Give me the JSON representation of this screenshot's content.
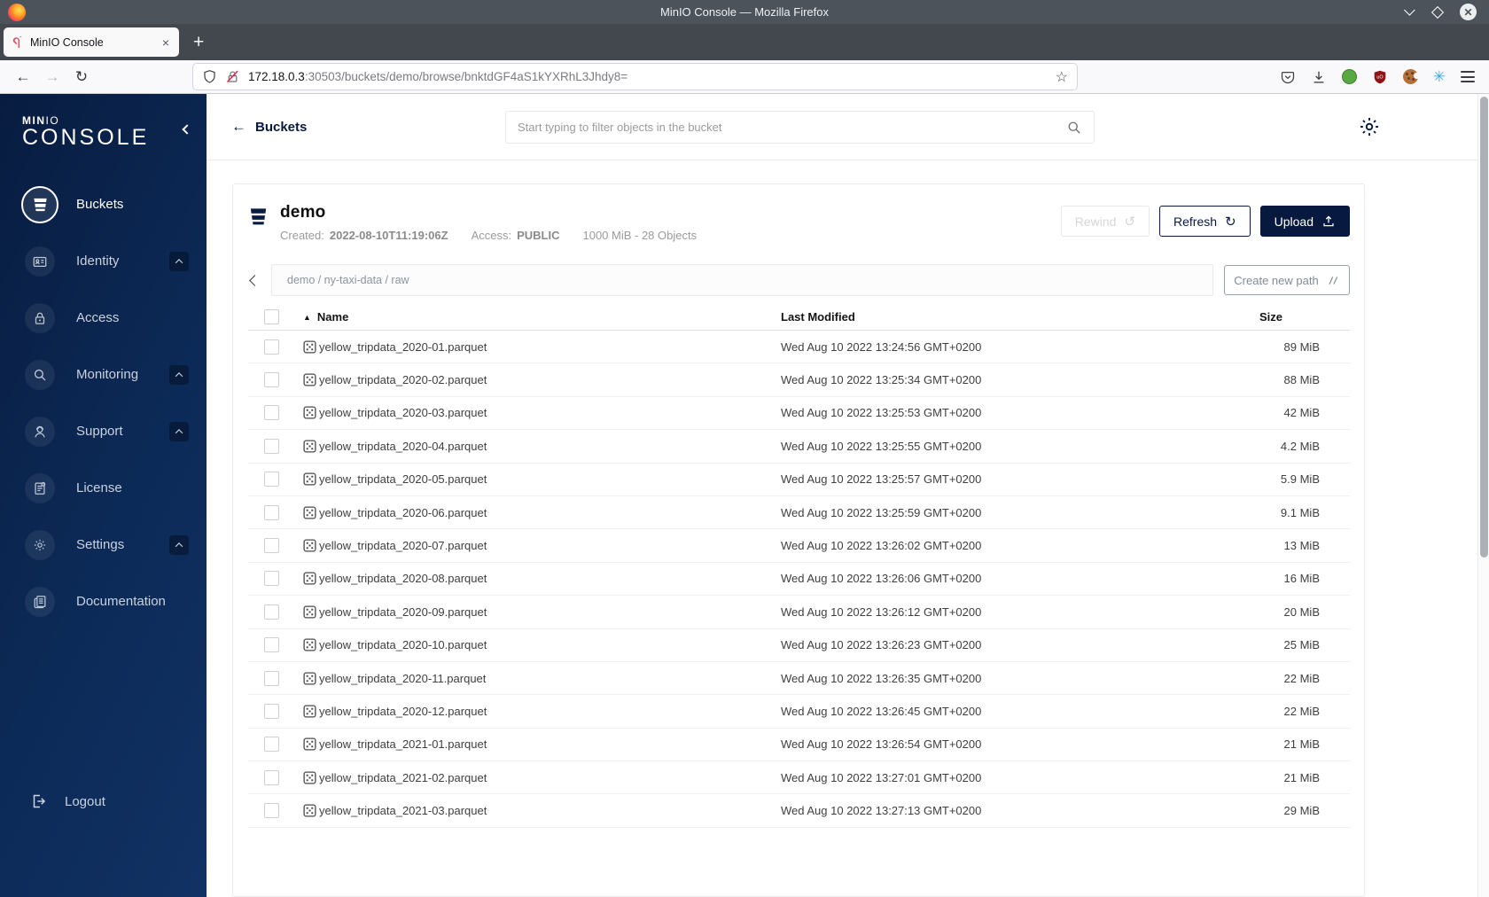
{
  "window": {
    "title": "MinIO Console — Mozilla Firefox",
    "controls": {
      "close_glyph": "✕"
    }
  },
  "tab": {
    "title": "MinIO Console",
    "close_glyph": "×",
    "new_tab_glyph": "+"
  },
  "nav": {
    "back_glyph": "←",
    "forward_glyph": "→",
    "reload_glyph": "↻"
  },
  "urlbar": {
    "host": "172.18.0.3",
    "path": ":30503/buckets/demo/browse/bnktdGF4aS1kYXRhL3Jhdy8=",
    "star_glyph": "☆"
  },
  "sidebar": {
    "logo": {
      "brand_bold": "MIN",
      "brand_light": "IO",
      "product": "CONSOLE"
    },
    "items": [
      {
        "label": "Buckets",
        "active": true,
        "expandable": false
      },
      {
        "label": "Identity",
        "active": false,
        "expandable": true
      },
      {
        "label": "Access",
        "active": false,
        "expandable": false
      },
      {
        "label": "Monitoring",
        "active": false,
        "expandable": true
      },
      {
        "label": "Support",
        "active": false,
        "expandable": true
      },
      {
        "label": "License",
        "active": false,
        "expandable": false
      },
      {
        "label": "Settings",
        "active": false,
        "expandable": true
      },
      {
        "label": "Documentation",
        "active": false,
        "expandable": false
      }
    ],
    "logout_label": "Logout"
  },
  "topbar": {
    "back_glyph": "←",
    "back_label": "Buckets",
    "search_placeholder": "Start typing to filter objects in the bucket"
  },
  "bucket_header": {
    "name": "demo",
    "created_label": "Created:",
    "created_value": "2022-08-10T11:19:06Z",
    "access_label": "Access:",
    "access_value": "PUBLIC",
    "usage": "1000 MiB - 28 Objects",
    "rewind_label": "Rewind",
    "rewind_glyph": "↺",
    "refresh_label": "Refresh",
    "refresh_glyph": "↻",
    "upload_label": "Upload"
  },
  "browse_bar": {
    "path": "demo / ny-taxi-data / raw",
    "path_parts": [
      "demo",
      "ny-taxi-data",
      "raw"
    ],
    "create_path_label": "Create new path"
  },
  "table": {
    "sort_glyph": "▲",
    "headers": {
      "name": "Name",
      "modified": "Last Modified",
      "size": "Size"
    },
    "rows": [
      {
        "name": "yellow_tripdata_2020-01.parquet",
        "modified": "Wed Aug 10 2022 13:24:56 GMT+0200",
        "size": "89 MiB"
      },
      {
        "name": "yellow_tripdata_2020-02.parquet",
        "modified": "Wed Aug 10 2022 13:25:34 GMT+0200",
        "size": "88 MiB"
      },
      {
        "name": "yellow_tripdata_2020-03.parquet",
        "modified": "Wed Aug 10 2022 13:25:53 GMT+0200",
        "size": "42 MiB"
      },
      {
        "name": "yellow_tripdata_2020-04.parquet",
        "modified": "Wed Aug 10 2022 13:25:55 GMT+0200",
        "size": "4.2 MiB"
      },
      {
        "name": "yellow_tripdata_2020-05.parquet",
        "modified": "Wed Aug 10 2022 13:25:57 GMT+0200",
        "size": "5.9 MiB"
      },
      {
        "name": "yellow_tripdata_2020-06.parquet",
        "modified": "Wed Aug 10 2022 13:25:59 GMT+0200",
        "size": "9.1 MiB"
      },
      {
        "name": "yellow_tripdata_2020-07.parquet",
        "modified": "Wed Aug 10 2022 13:26:02 GMT+0200",
        "size": "13 MiB"
      },
      {
        "name": "yellow_tripdata_2020-08.parquet",
        "modified": "Wed Aug 10 2022 13:26:06 GMT+0200",
        "size": "16 MiB"
      },
      {
        "name": "yellow_tripdata_2020-09.parquet",
        "modified": "Wed Aug 10 2022 13:26:12 GMT+0200",
        "size": "20 MiB"
      },
      {
        "name": "yellow_tripdata_2020-10.parquet",
        "modified": "Wed Aug 10 2022 13:26:23 GMT+0200",
        "size": "25 MiB"
      },
      {
        "name": "yellow_tripdata_2020-11.parquet",
        "modified": "Wed Aug 10 2022 13:26:35 GMT+0200",
        "size": "22 MiB"
      },
      {
        "name": "yellow_tripdata_2020-12.parquet",
        "modified": "Wed Aug 10 2022 13:26:45 GMT+0200",
        "size": "22 MiB"
      },
      {
        "name": "yellow_tripdata_2021-01.parquet",
        "modified": "Wed Aug 10 2022 13:26:54 GMT+0200",
        "size": "21 MiB"
      },
      {
        "name": "yellow_tripdata_2021-02.parquet",
        "modified": "Wed Aug 10 2022 13:27:01 GMT+0200",
        "size": "21 MiB"
      },
      {
        "name": "yellow_tripdata_2021-03.parquet",
        "modified": "Wed Aug 10 2022 13:27:13 GMT+0200",
        "size": "29 MiB"
      }
    ]
  },
  "colors": {
    "brand_navy": "#07193e",
    "sidebar_navy": "#0b2750",
    "insecure_red": "#e22850",
    "disabled_gray": "#d6d6d6"
  }
}
